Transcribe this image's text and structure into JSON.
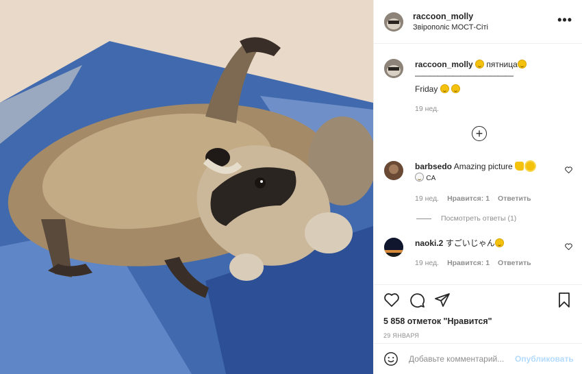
{
  "post": {
    "username": "raccoon_molly",
    "location": "Звірополіс МОСТ-Сіті",
    "more_label": "•••"
  },
  "caption": {
    "username": "raccoon_molly",
    "text_line1": "пятница",
    "text_line2": "—————————————",
    "text_line3": "Friday",
    "time": "19 нед."
  },
  "load_more_label": "+",
  "comments": [
    {
      "username": "barbsedo",
      "text": "Amazing picture",
      "text2": "CA",
      "time": "19 нед.",
      "likes": "Нравится: 1",
      "reply": "Ответить"
    },
    {
      "username": "naoki.2",
      "text": "すごいじゃん",
      "time": "19 нед.",
      "likes": "Нравится: 1",
      "reply": "Ответить"
    }
  ],
  "view_replies": "Посмотреть ответы (1)",
  "likes_count": "5 858 отметок \"Нравится\"",
  "date": "29 ЯНВАРЯ",
  "add_comment": {
    "placeholder": "Добавьте комментарий...",
    "publish_label": "Опубликовать"
  },
  "colors": {
    "publish": "#b3dbff",
    "secondary_text": "#8e8e8e",
    "border": "#efefef"
  },
  "icons": [
    "more-options-icon",
    "load-more-icon",
    "heart-icon",
    "comment-icon",
    "share-icon",
    "bookmark-icon",
    "emoji-icon"
  ]
}
